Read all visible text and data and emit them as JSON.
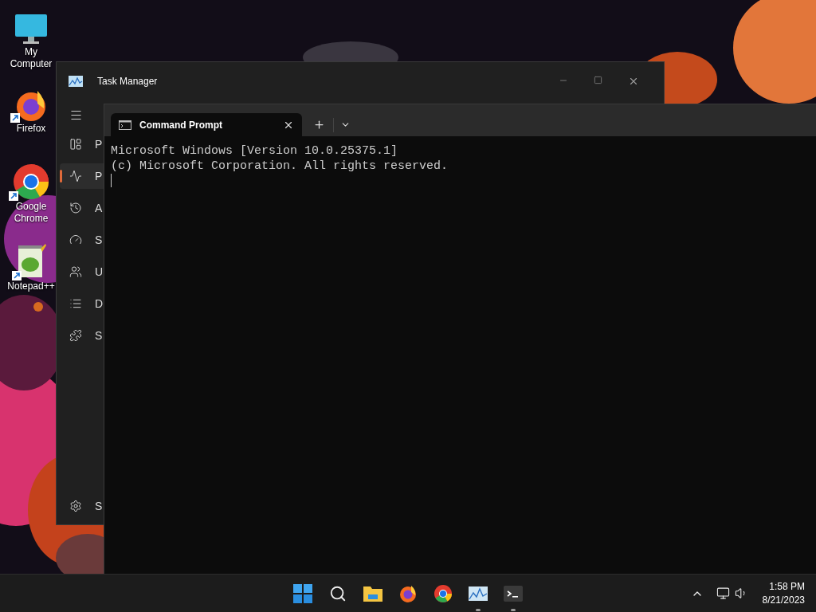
{
  "desktop_icons": [
    {
      "kind": "computer",
      "label": "My Computer",
      "shortcut": false
    },
    {
      "kind": "firefox",
      "label": "Firefox",
      "shortcut": true
    },
    {
      "kind": "chrome",
      "label": "Google Chrome",
      "shortcut": true
    },
    {
      "kind": "notepad",
      "label": "Notepad++",
      "shortcut": true
    }
  ],
  "task_manager": {
    "title": "Task Manager",
    "nav": [
      {
        "kind": "processes",
        "label": "P",
        "selected": false
      },
      {
        "kind": "performance",
        "label": "P",
        "selected": true
      },
      {
        "kind": "history",
        "label": "A",
        "selected": false
      },
      {
        "kind": "startup",
        "label": "S",
        "selected": false
      },
      {
        "kind": "users",
        "label": "U",
        "selected": false
      },
      {
        "kind": "details",
        "label": "D",
        "selected": false
      },
      {
        "kind": "services",
        "label": "S",
        "selected": false
      }
    ],
    "settings_label": "S"
  },
  "terminal": {
    "tab_title": "Command Prompt",
    "lines": [
      "Microsoft Windows [Version 10.0.25375.1]",
      "(c) Microsoft Corporation. All rights reserved."
    ]
  },
  "taskbar": {
    "apps": [
      {
        "kind": "start",
        "running": false
      },
      {
        "kind": "search",
        "running": false
      },
      {
        "kind": "explorer",
        "running": false
      },
      {
        "kind": "firefox",
        "running": false
      },
      {
        "kind": "chrome",
        "running": false
      },
      {
        "kind": "taskmanager",
        "running": true
      },
      {
        "kind": "terminal",
        "running": true
      }
    ],
    "time": "1:58 PM",
    "date": "8/21/2023"
  }
}
